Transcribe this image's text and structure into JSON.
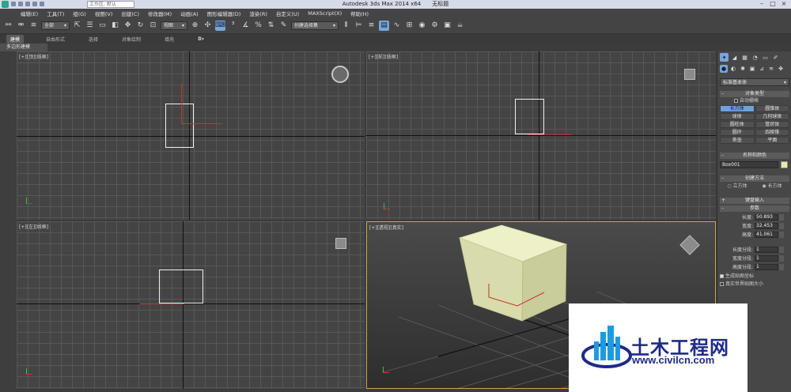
{
  "titlebar": {
    "app_title": "Autodesk 3ds Max  2014 x64",
    "file_title": "无标题",
    "search_placeholder": "工作区: 默认"
  },
  "menu": [
    "编辑(E)",
    "工具(T)",
    "组(G)",
    "视图(V)",
    "创建(C)",
    "修改器(M)",
    "动画(A)",
    "图形编辑器(D)",
    "渲染(R)",
    "自定义(U)",
    "MAXScript(X)",
    "帮助(H)"
  ],
  "toolbar": {
    "selection_filter": "全部",
    "reference_coord": "视图",
    "named_selection": "创建选择集"
  },
  "ribbon": {
    "tabs": [
      "建模",
      "自由形式",
      "选择",
      "对象绘制",
      "填充"
    ],
    "active_tab": "建模",
    "sub_label": "多边形建模"
  },
  "viewports": {
    "top": "[+][顶][线框]",
    "front": "[+][前][线框]",
    "left": "[+][左][线框]",
    "perspective": "[+][透视][真实]"
  },
  "command_panel": {
    "category": "标准基本体",
    "object_type": {
      "title": "对象类型",
      "autogrid": "自动栅格",
      "buttons": [
        "长方体",
        "圆锥体",
        "球体",
        "几何球体",
        "圆柱体",
        "管状体",
        "圆环",
        "四棱锥",
        "茶壶",
        "平面"
      ],
      "active": "长方体"
    },
    "name_color": {
      "title": "名称和颜色",
      "name": "Box001",
      "color": "#e8eab0"
    },
    "creation_method": {
      "title": "创建方法",
      "options": [
        "立方体",
        "长方体"
      ],
      "selected": "长方体"
    },
    "keyboard_entry": "键盘输入",
    "params": {
      "title": "参数",
      "length_label": "长度:",
      "length": "50.893",
      "width_label": "宽度:",
      "width": "32.453",
      "height_label": "高度:",
      "height": "41.061",
      "lsegs_label": "长度分段:",
      "lsegs": "1",
      "wsegs_label": "宽度分段:",
      "wsegs": "1",
      "hsegs_label": "高度分段:",
      "hsegs": "1",
      "gen_uv": "生成贴图坐标",
      "real_world": "真实世界贴图大小"
    }
  },
  "watermark": {
    "name": "土木工程网",
    "url": "www.civilcn.com"
  }
}
